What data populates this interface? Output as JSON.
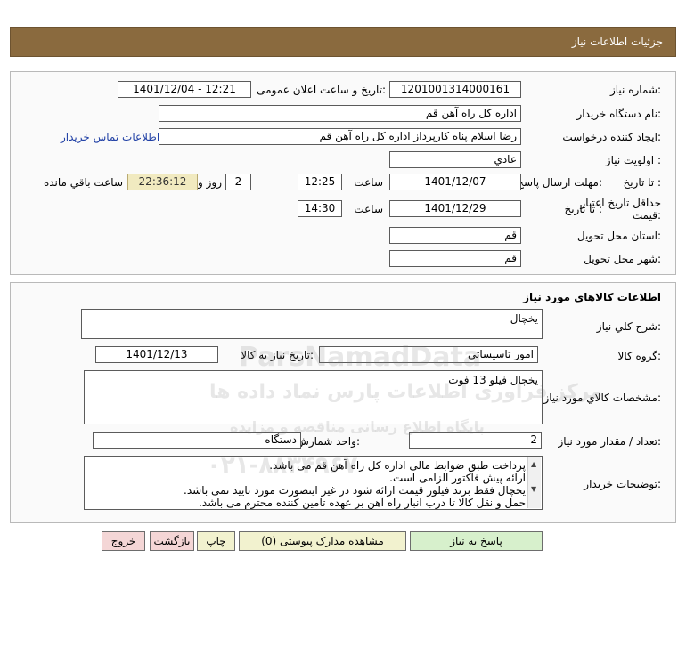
{
  "header": {
    "title": "جزئیات اطلاعات نیاز"
  },
  "need_info": {
    "need_number_label": "شماره نیاز:",
    "need_number": "1201001314000161",
    "announce_label": "تاریخ و ساعت اعلان عمومی:",
    "announce_value": "1401/12/04 - 12:21",
    "buyer_label": "نام دستگاه خریدار:",
    "buyer_value": "اداره کل  راه آهن قم",
    "creator_label": "ایجاد کننده درخواست:",
    "creator_value": "رضا اسلام پناه کارپرداز اداره کل  راه آهن قم",
    "contact_link": "اطلاعات تماس خریدار",
    "priority_label": "اولویت نیاز :",
    "priority_value": "عادي",
    "deadline_label": "مهلت ارسال پاسخ:",
    "until_date_label": "تا تاریخ :",
    "deadline_date": "1401/12/07",
    "time_label": "ساعت",
    "deadline_time": "12:25",
    "days_value": "2",
    "days_label": "روز و",
    "remaining_value": "22:36:12",
    "remaining_label": "ساعت باقي مانده",
    "validity_label_1": "حداقل تاریخ اعتبار",
    "validity_label_2": "قیمت:",
    "validity_until_label": "تا تاریخ :",
    "validity_date": "1401/12/29",
    "validity_time_label": "ساعت",
    "validity_time": "14:30",
    "province_label": "استان محل تحویل:",
    "province_value": "قم",
    "city_label": "شهر محل تحویل:",
    "city_value": "قم"
  },
  "goods": {
    "section_title": "اطلاعات کالاهاي مورد نياز",
    "general_desc_label": "شرح کلي نياز:",
    "general_desc_value": "یخچال",
    "group_label": "گروه کالا:",
    "group_value": "امور تاسیساتی",
    "need_date_label": "تاریخ نیاز به کالا:",
    "need_date_value": "1401/12/13",
    "specs_label": "مشخصات کالاي مورد نياز:",
    "specs_value": "یخچال فیلو 13 فوت",
    "qty_label": "تعداد / مقدار مورد نیاز:",
    "qty_value": "2",
    "unit_label": "واحد شمارش:",
    "unit_value": "دستگاه",
    "buyer_notes_label": "توضیحات خریدار:",
    "buyer_notes": [
      "پرداخت طبق ضوابط مالی اداره کل راه آهن قم می باشد.",
      "ارائه پیش فاکتور الزامی است.",
      "یخچال فقط برند فیلور قیمت ارائه شود در غیر اینصورت مورد تایید نمی باشد.",
      "حمل و نقل کالا تا درب انبار راه آهن بر عهده تامین کننده محترم می باشد."
    ]
  },
  "buttons": {
    "reply": "پاسخ به نیاز",
    "attachments": "مشاهده مدارک پیوستی (0)",
    "print": "چاپ",
    "back": "بازگشت",
    "exit": "خروج"
  },
  "watermark": {
    "line1": "ParsNamadData",
    "line2": "مرکز فراوری اطلاعات پارس نماد داده ها",
    "line3": "پایگاه اطلاع رسانی مناقصه و مزایده",
    "phone": "۰۲۱-۸۸۳۴۹۶۷"
  },
  "colors": {
    "header_bg": "#8a6a3e",
    "link": "#1f3fa5",
    "remaining_bg": "#f1eac0"
  }
}
